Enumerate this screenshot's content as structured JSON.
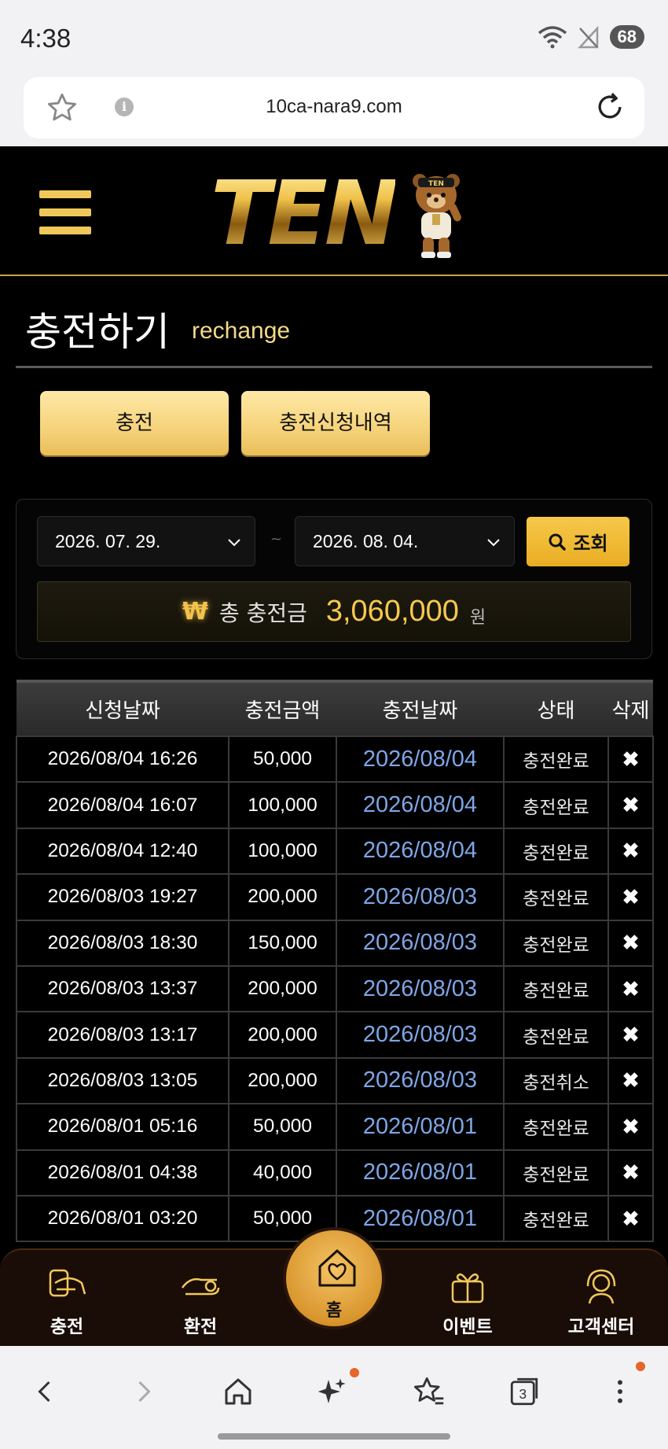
{
  "status_bar": {
    "time": "4:38",
    "battery": "68"
  },
  "browser": {
    "url": "10ca-nara9.com",
    "tab_count": "3"
  },
  "site_header": {
    "logo_text": "TEN",
    "bear_cap_text": "TEN"
  },
  "page": {
    "title": "충전하기",
    "subtitle": "rechange"
  },
  "tabs": [
    {
      "label": "충전"
    },
    {
      "label": "충전신청내역"
    }
  ],
  "filter": {
    "date_from": "2026. 07. 29.",
    "separator": "~",
    "date_to": "2026. 08. 04.",
    "search_label": "조회"
  },
  "total": {
    "icon": "₩",
    "label": "총 충전금",
    "amount": "3,060,000",
    "unit": "원"
  },
  "table": {
    "headers": [
      "신청날짜",
      "충전금액",
      "충전날짜",
      "상태",
      "삭제"
    ],
    "rows": [
      {
        "requested": "2026/08/04 16:26",
        "amount": "50,000",
        "charged": "2026/08/04",
        "status": "충전완료",
        "delete": "✖"
      },
      {
        "requested": "2026/08/04 16:07",
        "amount": "100,000",
        "charged": "2026/08/04",
        "status": "충전완료",
        "delete": "✖"
      },
      {
        "requested": "2026/08/04 12:40",
        "amount": "100,000",
        "charged": "2026/08/04",
        "status": "충전완료",
        "delete": "✖"
      },
      {
        "requested": "2026/08/03 19:27",
        "amount": "200,000",
        "charged": "2026/08/03",
        "status": "충전완료",
        "delete": "✖"
      },
      {
        "requested": "2026/08/03 18:30",
        "amount": "150,000",
        "charged": "2026/08/03",
        "status": "충전완료",
        "delete": "✖"
      },
      {
        "requested": "2026/08/03 13:37",
        "amount": "200,000",
        "charged": "2026/08/03",
        "status": "충전완료",
        "delete": "✖"
      },
      {
        "requested": "2026/08/03 13:17",
        "amount": "200,000",
        "charged": "2026/08/03",
        "status": "충전완료",
        "delete": "✖"
      },
      {
        "requested": "2026/08/03 13:05",
        "amount": "200,000",
        "charged": "2026/08/03",
        "status": "충전취소",
        "delete": "✖"
      },
      {
        "requested": "2026/08/01 05:16",
        "amount": "50,000",
        "charged": "2026/08/01",
        "status": "충전완료",
        "delete": "✖"
      },
      {
        "requested": "2026/08/01 04:38",
        "amount": "40,000",
        "charged": "2026/08/01",
        "status": "충전완료",
        "delete": "✖"
      },
      {
        "requested": "2026/08/01 03:20",
        "amount": "50,000",
        "charged": "2026/08/01",
        "status": "충전완료",
        "delete": "✖"
      }
    ]
  },
  "bottom_nav": {
    "charge": "충전",
    "exchange": "환전",
    "home": "홈",
    "event": "이벤트",
    "support": "고객센터"
  },
  "colors": {
    "accent_gold": "#f6c94e",
    "link_blue": "#7ea6e6",
    "background": "#000000"
  }
}
